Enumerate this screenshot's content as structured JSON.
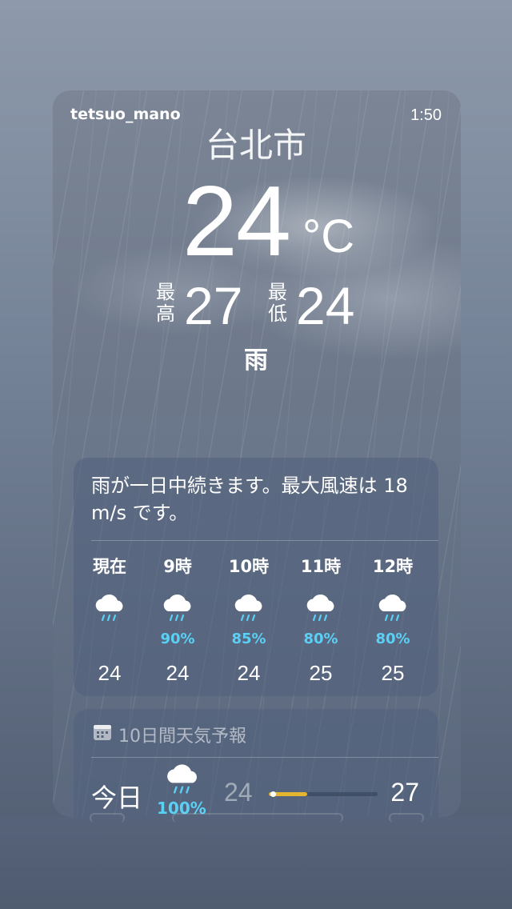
{
  "status": {
    "username": "tetsuo_mano",
    "time": "1:50"
  },
  "weather": {
    "city": "台北市",
    "temperature": "24",
    "unit": "°C",
    "high_label": "最高",
    "high": "27",
    "low_label": "最低",
    "low": "24",
    "condition": "雨"
  },
  "hourly": {
    "summary": "雨が一日中続きます。最大風速は 18 m/s です。",
    "items": [
      {
        "time": "現在",
        "icon": "cloud-rain-icon",
        "chance": "",
        "temp": "24"
      },
      {
        "time": "9時",
        "icon": "cloud-rain-icon",
        "chance": "90%",
        "temp": "24"
      },
      {
        "time": "10時",
        "icon": "cloud-rain-icon",
        "chance": "85%",
        "temp": "24"
      },
      {
        "time": "11時",
        "icon": "cloud-rain-icon",
        "chance": "80%",
        "temp": "25"
      },
      {
        "time": "12時",
        "icon": "cloud-rain-icon",
        "chance": "80%",
        "temp": "25"
      }
    ]
  },
  "daily": {
    "header": "10日間天気予報",
    "header_icon": "calendar-icon",
    "rows": [
      {
        "day": "今日",
        "icon": "cloud-rain-icon",
        "chance": "100%",
        "low": "24",
        "high": "27"
      }
    ]
  },
  "colors": {
    "precip_chance": "#5ad0f5",
    "temp_bar": "#e4b530"
  }
}
